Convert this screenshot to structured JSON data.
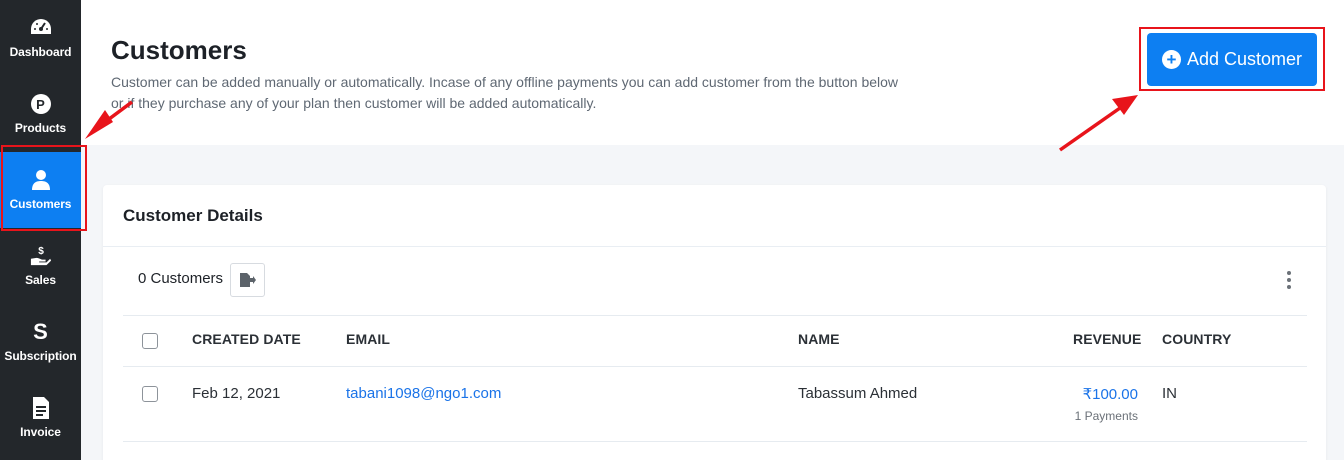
{
  "sidebar": {
    "items": [
      {
        "label": "Dashboard",
        "icon": "gauge-icon"
      },
      {
        "label": "Products",
        "icon": "p-circle-icon"
      },
      {
        "label": "Customers",
        "icon": "user-icon",
        "active": true
      },
      {
        "label": "Sales",
        "icon": "hand-dollar-icon"
      },
      {
        "label": "Subscription",
        "icon": "s-icon"
      },
      {
        "label": "Invoice",
        "icon": "document-icon"
      }
    ],
    "products_glyph": "P",
    "subscription_glyph": "S"
  },
  "header": {
    "title": "Customers",
    "description": "Customer can be added manually or automatically. Incase of any offline payments you can add customer from the button below or if they purchase any of your plan then customer will be added automatically.",
    "add_button_label": "Add Customer",
    "add_button_glyph": "+"
  },
  "card": {
    "title": "Customer Details",
    "count_label": "0 Customers",
    "columns": [
      "CREATED DATE",
      "EMAIL",
      "NAME",
      "REVENUE",
      "COUNTRY"
    ],
    "rows": [
      {
        "created_date": "Feb 12, 2021",
        "email": "tabani1098@ngo1.com",
        "name": "Tabassum Ahmed",
        "revenue": "₹100.00",
        "payments": "1 Payments",
        "country": "IN"
      }
    ]
  },
  "colors": {
    "sidebar_bg": "#23272b",
    "accent": "#0d7ff2",
    "link": "#1a73e8",
    "annotation_red": "#e8141b"
  }
}
